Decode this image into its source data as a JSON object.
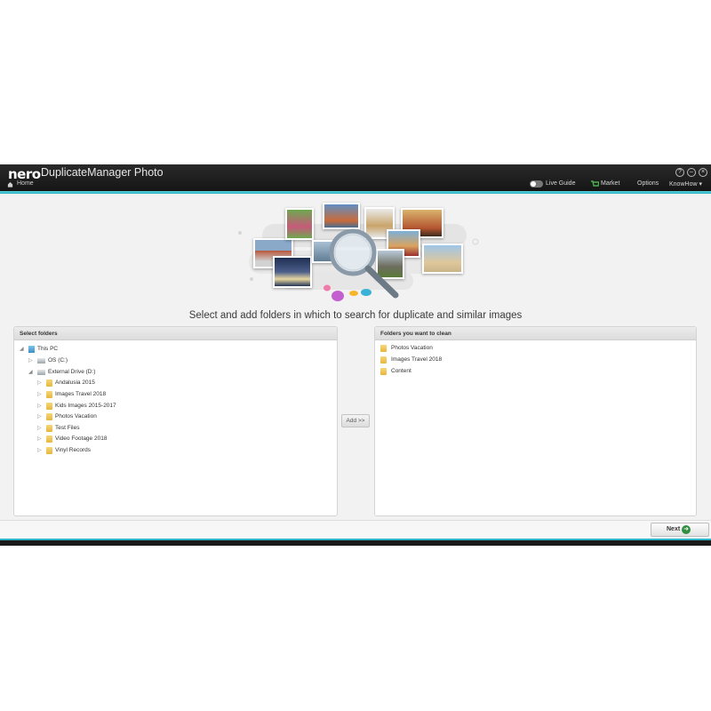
{
  "app": {
    "logo": "nero",
    "title": "DuplicateManager Photo",
    "home_label": "Home"
  },
  "nav": {
    "live_guide": "Live Guide",
    "market": "Market",
    "options": "Options",
    "knowhow": "KnowHow"
  },
  "headline": "Select and add folders in which to search for duplicate and similar images",
  "left_panel": {
    "title": "Select folders",
    "tree": [
      {
        "label": "This PC",
        "icon": "pc-icon",
        "arrow": "◢"
      },
      {
        "label": "OS (C:)",
        "icon": "drive-icon",
        "arrow": "▷"
      },
      {
        "label": "External Drive (D:)",
        "icon": "drive-icon",
        "arrow": "◢"
      },
      {
        "label": "Andalusia 2015",
        "icon": "folder-icon",
        "arrow": "▷"
      },
      {
        "label": "Images Travel 2018",
        "icon": "folder-icon",
        "arrow": "▷"
      },
      {
        "label": "Kids Images 2015-2017",
        "icon": "folder-icon",
        "arrow": "▷"
      },
      {
        "label": "Photos Vacation",
        "icon": "folder-icon",
        "arrow": "▷"
      },
      {
        "label": "Test Files",
        "icon": "folder-icon",
        "arrow": "▷"
      },
      {
        "label": "Video Footage 2018",
        "icon": "folder-icon",
        "arrow": "▷"
      },
      {
        "label": "Vinyl Records",
        "icon": "folder-icon",
        "arrow": "▷"
      }
    ]
  },
  "right_panel": {
    "title": "Folders you want to clean",
    "items": [
      "Photos Vacation",
      "Images Travel 2018",
      "Content"
    ]
  },
  "buttons": {
    "add": "Add >>",
    "next": "Next"
  },
  "colors": {
    "accent": "#2aaec0",
    "folder": "#e8b63a",
    "next_icon": "#2f8f3f"
  }
}
